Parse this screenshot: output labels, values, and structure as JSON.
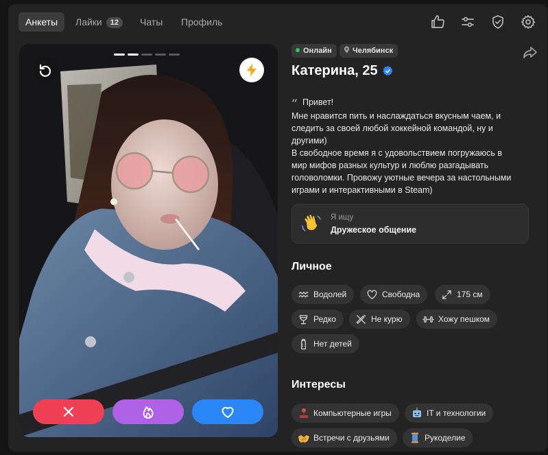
{
  "nav": {
    "tabs": [
      {
        "label": "Анкеты",
        "active": true
      },
      {
        "label": "Лайки",
        "badge": "12"
      },
      {
        "label": "Чаты"
      },
      {
        "label": "Профиль"
      }
    ],
    "icons": [
      "thumbs-up-icon",
      "filter-sliders-icon",
      "shield-check-icon",
      "gear-icon"
    ]
  },
  "photo": {
    "slide_count": 5,
    "current_slide": 2,
    "icons": {
      "undo": "rotate-undo-icon",
      "boost": "lightning-icon",
      "dislike": "close-icon",
      "super": "fire-icon",
      "like": "heart-icon"
    },
    "colors": {
      "dislike": "#f04055",
      "super": "#b062e6",
      "like": "#2b86f6"
    }
  },
  "profile": {
    "status": "Онлайн",
    "city": "Челябинск",
    "name_age": "Катерина, 25",
    "verified": true,
    "bio_lines": [
      "Привет!",
      "Мне нравится пить и наслаждаться вкусным чаем, и",
      "следить за своей любой хоккейной командой, ну и",
      "другими)",
      "В свободное время я с удовольствием погружаюсь в",
      "мир мифов разных культур и люблю разгадывать",
      "головоломки. Провожу уютные вечера за настольными",
      "играми и интерактивными в Steam)"
    ],
    "seeking": {
      "label": "Я ищу",
      "value": "Дружеское общение"
    }
  },
  "personal": {
    "title": "Личное",
    "tags": [
      {
        "label": "Водолей",
        "icon": "aquarius-icon"
      },
      {
        "label": "Свободна",
        "icon": "heart-outline-icon"
      },
      {
        "label": "175 см",
        "icon": "expand-arrows-icon"
      },
      {
        "label": "Редко",
        "icon": "wine-glass-icon"
      },
      {
        "label": "Не курю",
        "icon": "no-smoking-icon"
      },
      {
        "label": "Хожу пешком",
        "icon": "dumbbell-icon"
      },
      {
        "label": "Нет детей",
        "icon": "baby-bottle-icon"
      }
    ]
  },
  "interests": {
    "title": "Интересы",
    "tags": [
      {
        "label": "Компьютерные игры",
        "icon": "joystick-icon"
      },
      {
        "label": "IT и технологии",
        "icon": "robot-icon"
      },
      {
        "label": "Встречи с друзьями",
        "icon": "handshake-icon"
      },
      {
        "label": "Рукоделие",
        "icon": "thread-spool-icon"
      }
    ]
  }
}
